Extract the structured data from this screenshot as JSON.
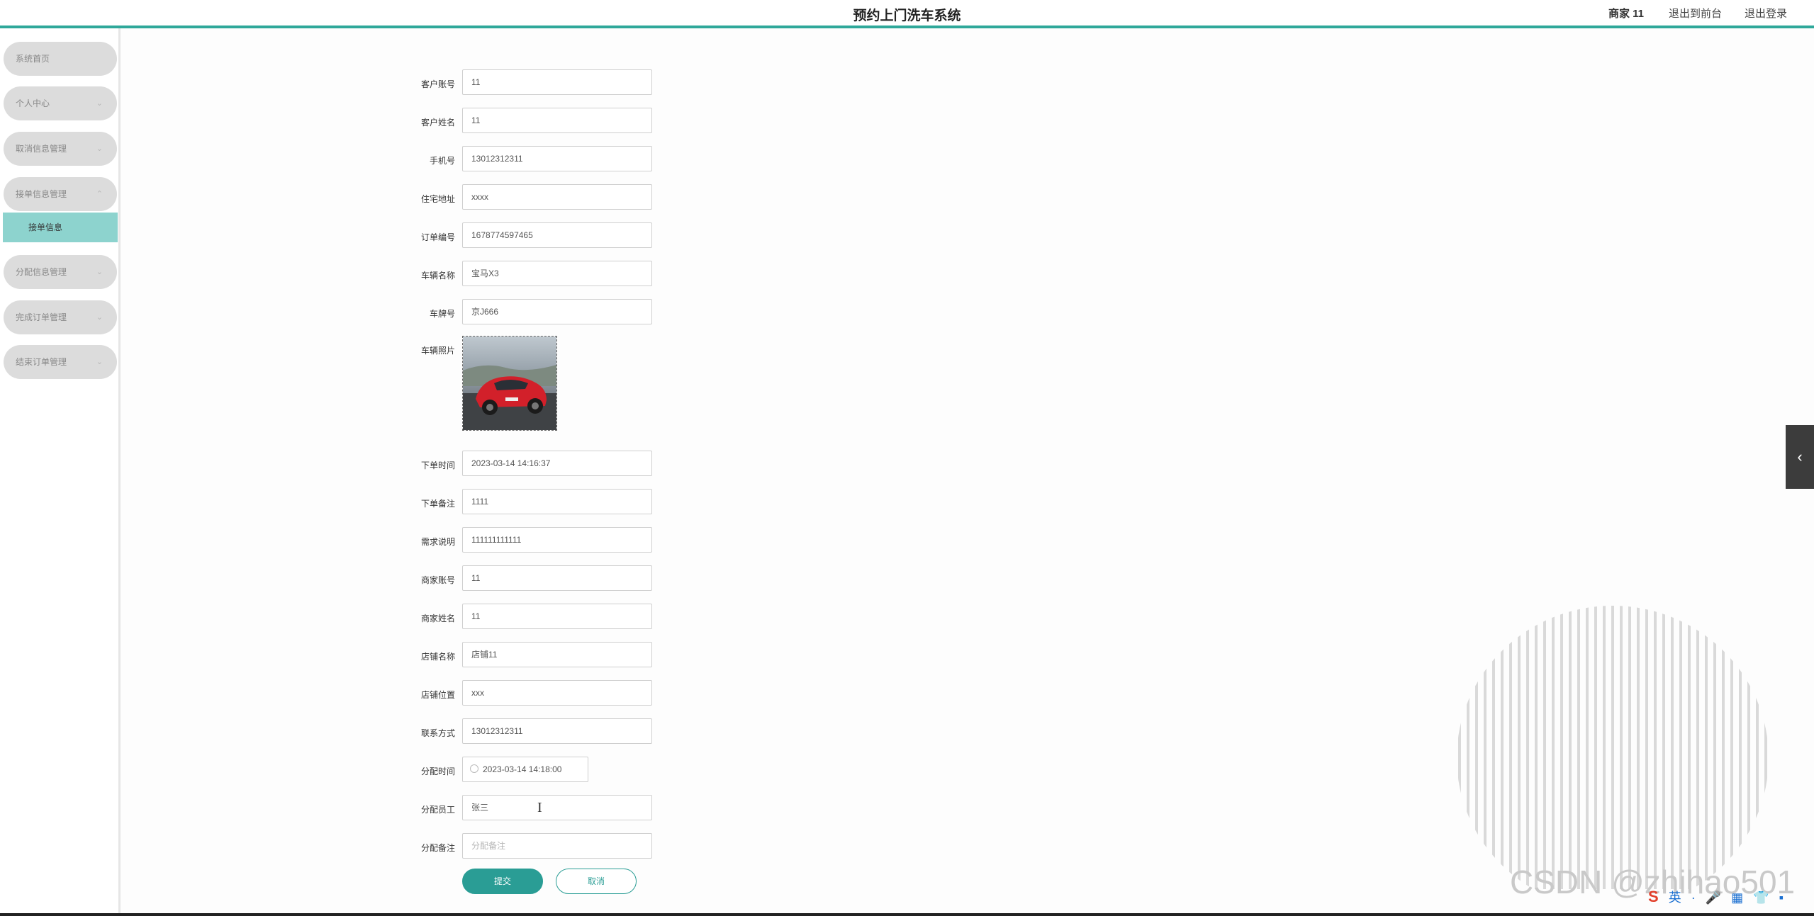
{
  "header": {
    "title": "预约上门洗车系统",
    "merchant": "商家 11",
    "to_front": "退出到前台",
    "logout": "退出登录"
  },
  "sidebar": {
    "items": [
      {
        "label": "系统首页",
        "has_chevron": false
      },
      {
        "label": "个人中心",
        "has_chevron": true
      },
      {
        "label": "取消信息管理",
        "has_chevron": true
      },
      {
        "label": "接单信息管理",
        "has_chevron": true,
        "expanded": true
      },
      {
        "label": "分配信息管理",
        "has_chevron": true
      },
      {
        "label": "完成订单管理",
        "has_chevron": true
      },
      {
        "label": "结束订单管理",
        "has_chevron": true
      }
    ],
    "active_sub": "接单信息",
    "chevron_down": "⌄",
    "chevron_up": "⌃"
  },
  "form": {
    "fields": [
      {
        "label": "客户账号",
        "value": "11"
      },
      {
        "label": "客户姓名",
        "value": "11"
      },
      {
        "label": "手机号",
        "value": "13012312311"
      },
      {
        "label": "住宅地址",
        "value": "xxxx"
      },
      {
        "label": "订单编号",
        "value": "1678774597465"
      },
      {
        "label": "车辆名称",
        "value": "宝马X3"
      },
      {
        "label": "车牌号",
        "value": "京J666"
      }
    ],
    "photo_label": "车辆照片",
    "fields2": [
      {
        "label": "下单时间",
        "value": "2023-03-14 14:16:37"
      },
      {
        "label": "下单备注",
        "value": "1111"
      },
      {
        "label": "需求说明",
        "value": "111111111111"
      },
      {
        "label": "商家账号",
        "value": "11"
      },
      {
        "label": "商家姓名",
        "value": "11"
      },
      {
        "label": "店铺名称",
        "value": "店铺11"
      },
      {
        "label": "店铺位置",
        "value": "xxx"
      },
      {
        "label": "联系方式",
        "value": "13012312311"
      }
    ],
    "assign_time_label": "分配时间",
    "assign_time_value": "2023-03-14 14:18:00",
    "assign_staff_label": "分配员工",
    "assign_staff_value": "张三",
    "assign_note_label": "分配备注",
    "assign_note_placeholder": "分配备注",
    "submit": "提交",
    "cancel": "取消"
  },
  "side_tab_icon": "‹",
  "watermark": "CSDN @zhihao501",
  "ime": {
    "logo": "S",
    "lang": "英",
    "items": [
      "·",
      "🎤",
      "▦",
      "👕",
      "▪"
    ]
  },
  "colors": {
    "accent": "#2fa89a",
    "active_sub_bg": "#8dd3ce",
    "button": "#2a9d95"
  }
}
